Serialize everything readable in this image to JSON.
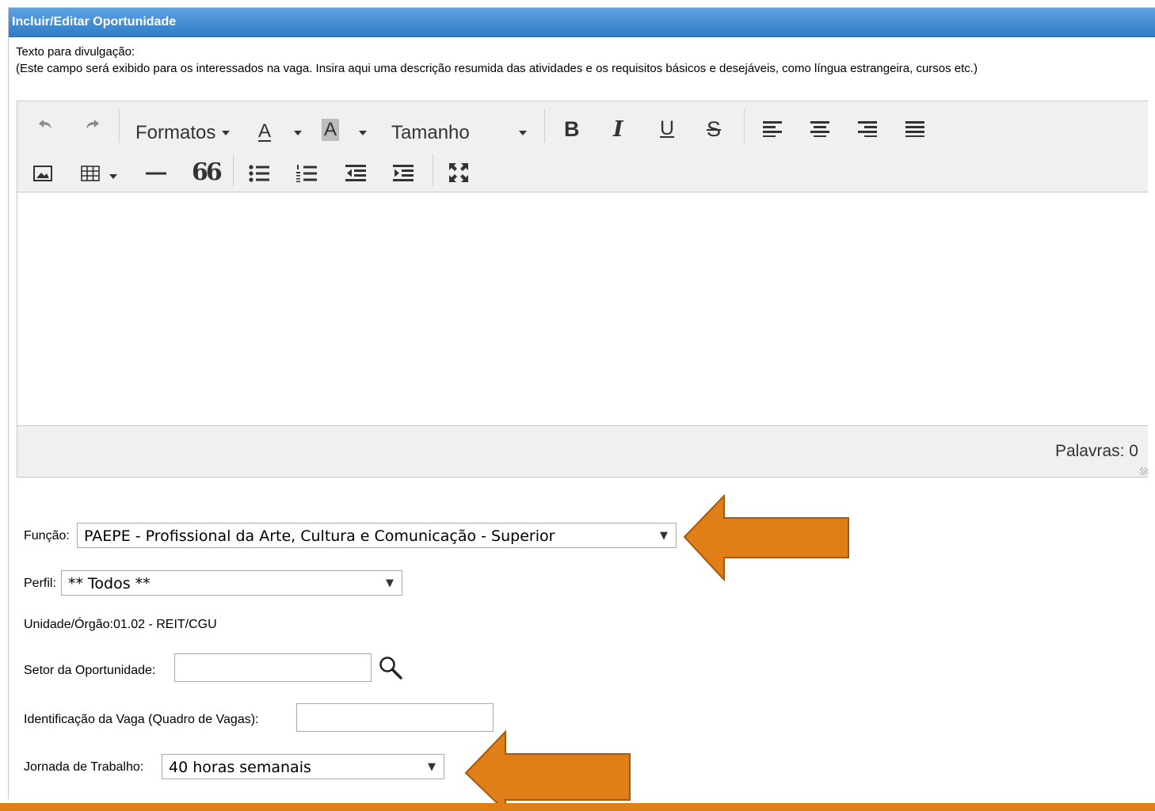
{
  "window": {
    "title": "Incluir/Editar Oportunidade"
  },
  "instructions": {
    "label": "Texto para divulgação:",
    "help": "(Este campo será exibido para os interessados na vaga. Insira aqui uma descrição resumida das atividades e os requisitos básicos e desejáveis, como língua estrangeira, cursos etc.)"
  },
  "editor": {
    "formats_label": "Formatos",
    "size_label": "Tamanho",
    "font_color_glyph": "A",
    "bg_color_glyph": "A",
    "bold_glyph": "B",
    "italic_glyph": "I",
    "underline_glyph": "U",
    "strike_glyph": "S",
    "quote_glyph": "66",
    "word_count": "Palavras: 0"
  },
  "form": {
    "funcao_label": "Função:",
    "funcao_value": "PAEPE - Profissional da Arte, Cultura e Comunicação - Superior",
    "perfil_label": "Perfil:",
    "perfil_value": "** Todos **",
    "unidade_text": "Unidade/Órgão:01.02 - REIT/CGU",
    "setor_label": "Setor da Oportunidade:",
    "setor_value": "",
    "identificacao_label": "Identificação da Vaga (Quadro de Vagas):",
    "identificacao_value": "",
    "jornada_label": "Jornada de Trabalho:",
    "jornada_value": "40 horas semanais"
  },
  "colors": {
    "titlebar": "#2f7cc9",
    "annotation_arrow": "#e07e17"
  }
}
